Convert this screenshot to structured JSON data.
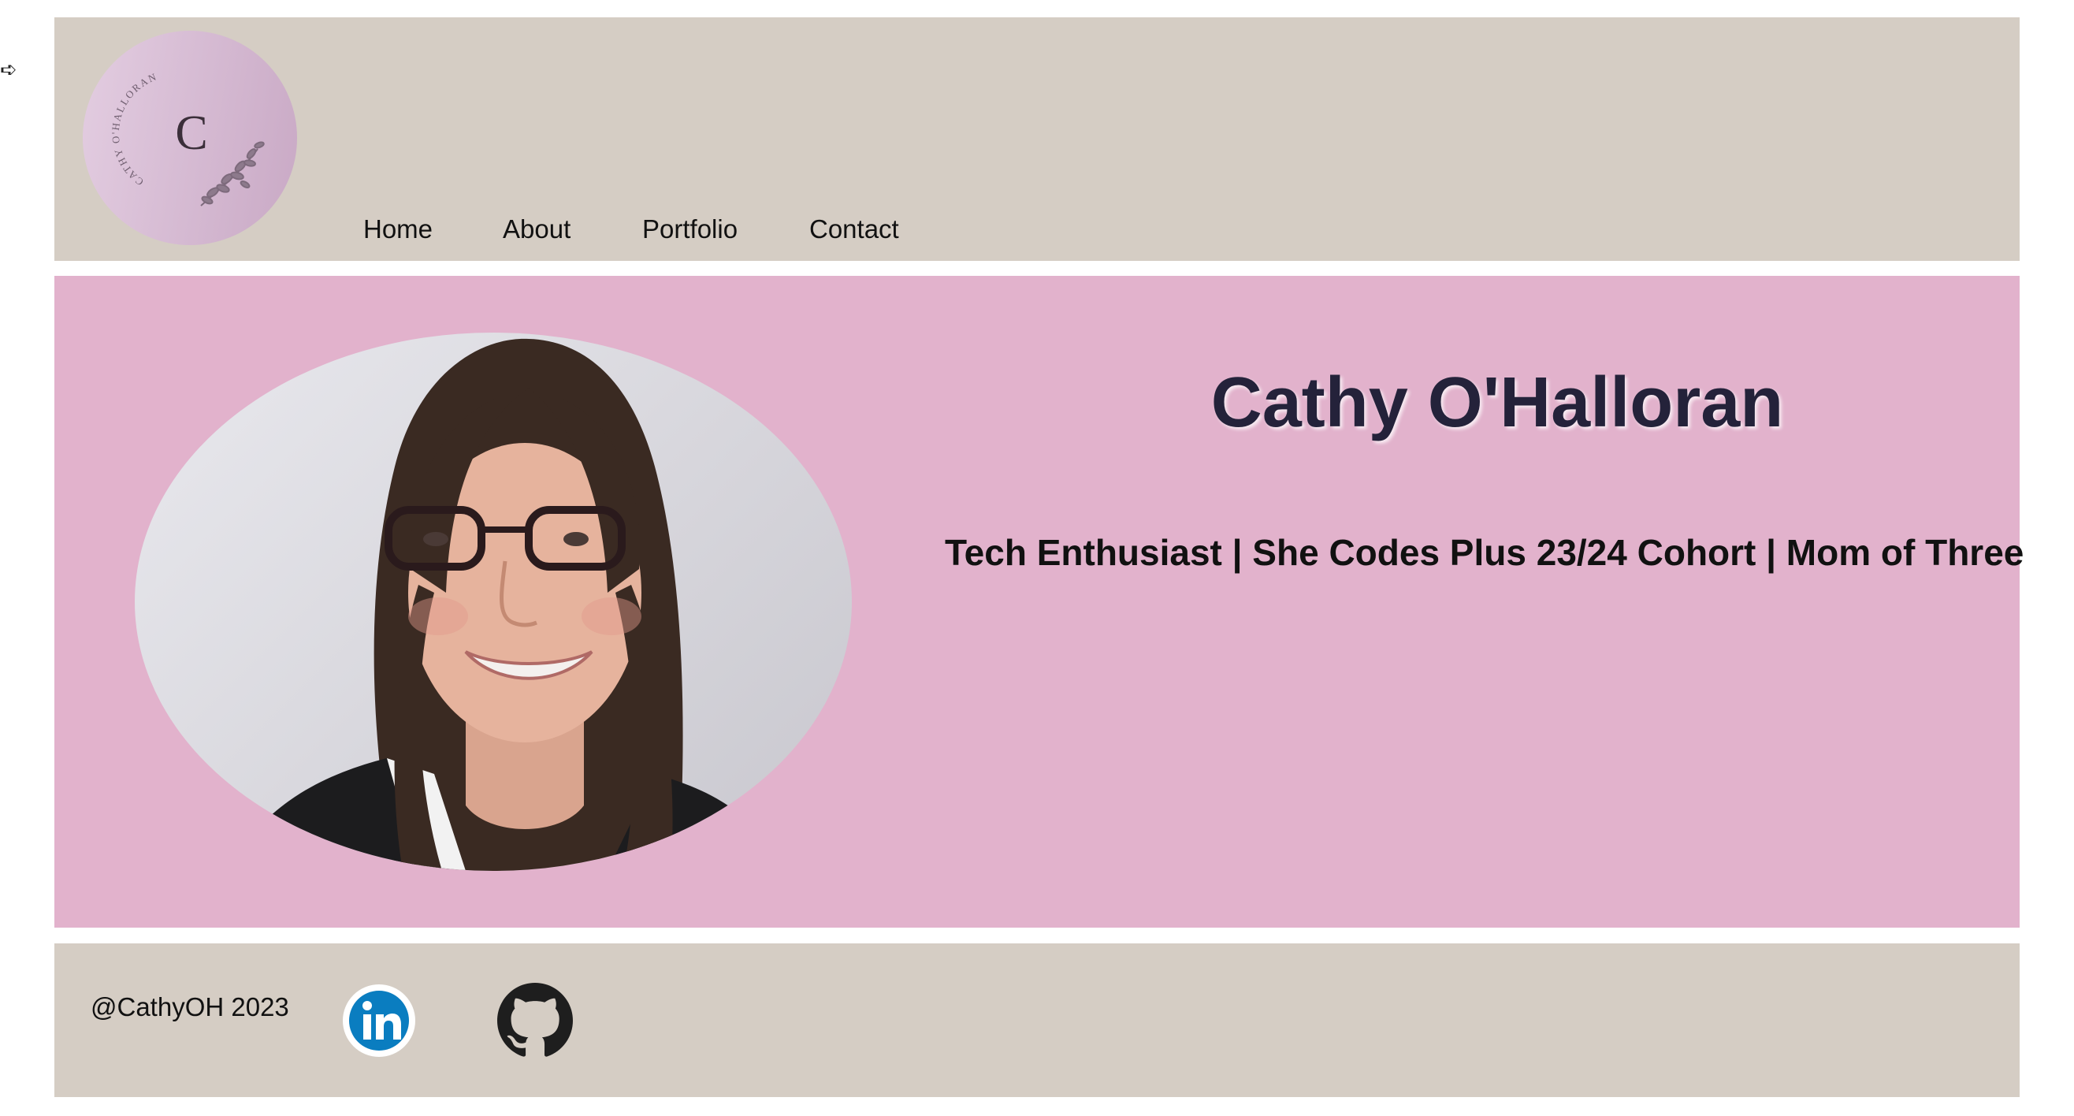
{
  "header": {
    "logo": {
      "letter": "C",
      "ring_text": "CATHY O'HALLORAN",
      "colors": {
        "start": "#e3cde1",
        "end": "#c9a9c5"
      }
    },
    "nav": [
      {
        "label": "Home"
      },
      {
        "label": "About"
      },
      {
        "label": "Portfolio"
      },
      {
        "label": "Contact"
      }
    ]
  },
  "hero": {
    "name": "Cathy O'Halloran",
    "tagline": "Tech Enthusiast | She Codes Plus 23/24 Cohort | Mom of Three",
    "photo_icon": "profile-photo"
  },
  "footer": {
    "copyright": "@CathyOH 2023",
    "social": [
      {
        "name": "linkedin",
        "icon": "linkedin-icon"
      },
      {
        "name": "github",
        "icon": "github-icon"
      }
    ]
  },
  "colors": {
    "header_bg": "#d5cdc4",
    "hero_bg": "#e2b2cc",
    "footer_bg": "#d5cdc4",
    "name_color": "#24223a",
    "linkedin_blue": "#0a7dc0"
  }
}
